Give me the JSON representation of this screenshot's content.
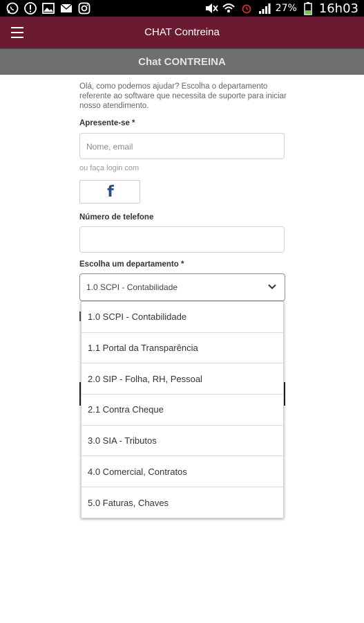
{
  "statusbar": {
    "battery_pct": "27%",
    "time": "16h03",
    "icons": [
      "whatsapp-icon",
      "alert-icon",
      "image-icon",
      "mail-icon",
      "instagram-icon",
      "mute-icon",
      "wifi-icon",
      "alarm-icon",
      "signal-icon",
      "battery-icon"
    ]
  },
  "appbar": {
    "title": "CHAT Contreina"
  },
  "subbar": {
    "title": "Chat CONTREINA"
  },
  "form": {
    "intro": "Olá, como podemos ajudar? Escolha o departamento referente ao software que necessita de suporte para iniciar nosso atendimento.",
    "name_label": "Apresente-se *",
    "name_placeholder": "Nome, email",
    "login_hint": "ou faça login com",
    "fb_letter": "f",
    "phone_label": "Número de telefone",
    "dept_label": "Escolha um departamento *",
    "dept_selected": "1.0 SCPI - Contabilidade"
  },
  "dropdown": {
    "options": [
      "1.0 SCPI - Contabilidade",
      "1.1 Portal da Transparência",
      "2.0 SIP - Folha, RH, Pessoal",
      "2.1 Contra Cheque",
      "3.0 SIA - Tributos",
      "4.0 Comercial, Contratos",
      "5.0 Faturas, Chaves"
    ]
  }
}
